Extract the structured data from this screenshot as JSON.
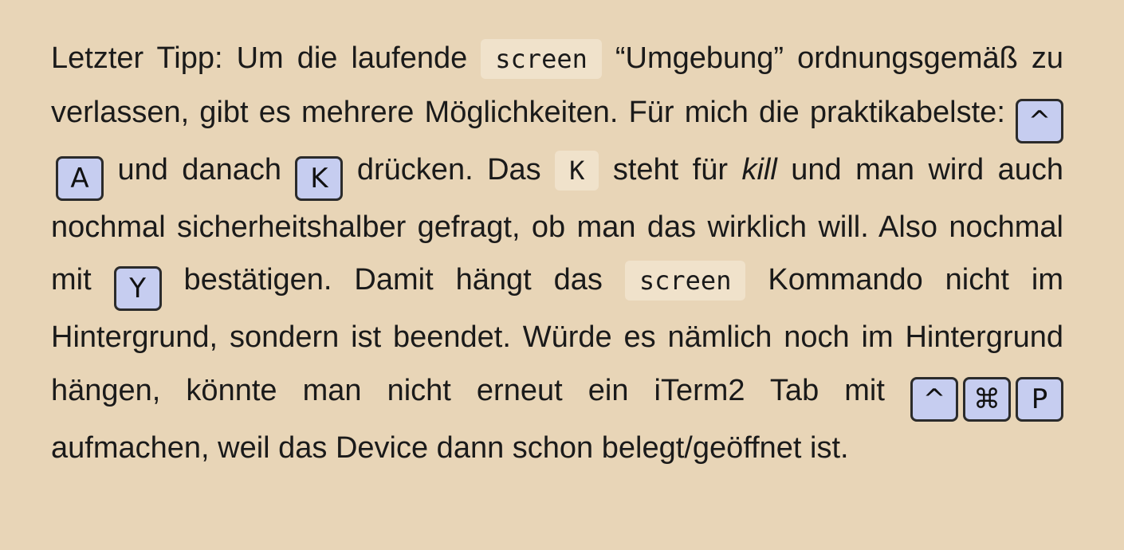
{
  "paragraph": {
    "p1": "Letzter Tipp: Um die laufende ",
    "code1": "screen",
    "p2": " “Umgebung” ordnungsge­mäß zu verlassen, gibt es mehrere Möglichkeiten. Für mich die praktikabelste: ",
    "key_ctrl_1": "^",
    "key_a": "A",
    "p3": " und danach ",
    "key_k": "K",
    "p4": " drücken. Das ",
    "code2": "K",
    "p5": " steht für ",
    "em1": "kill",
    "p6": " und man wird auch nochmal sicherheitshalber gefragt, ob man das wirklich will. Also nochmal mit ",
    "key_y": "Y",
    "p7": " bestätigen. Damit hängt das ",
    "code3": "screen",
    "p8": " Kommando nicht im Hintergrund, sondern ist beendet. Würde es nämlich noch im Hintergrund hängen, könnte man nicht erneut ein iTerm2 Tab mit ",
    "key_ctrl_2": "^",
    "key_cmd": "⌘",
    "key_p": "P",
    "p9": " aufmachen, weil das Device dann schon belegt/geöffnet ist."
  },
  "colors": {
    "background": "#e8d5b7",
    "text": "#1a1a1a",
    "code_background": "#f0e2cb",
    "key_background": "#c6cdf0",
    "key_border": "#2b2b2b"
  }
}
